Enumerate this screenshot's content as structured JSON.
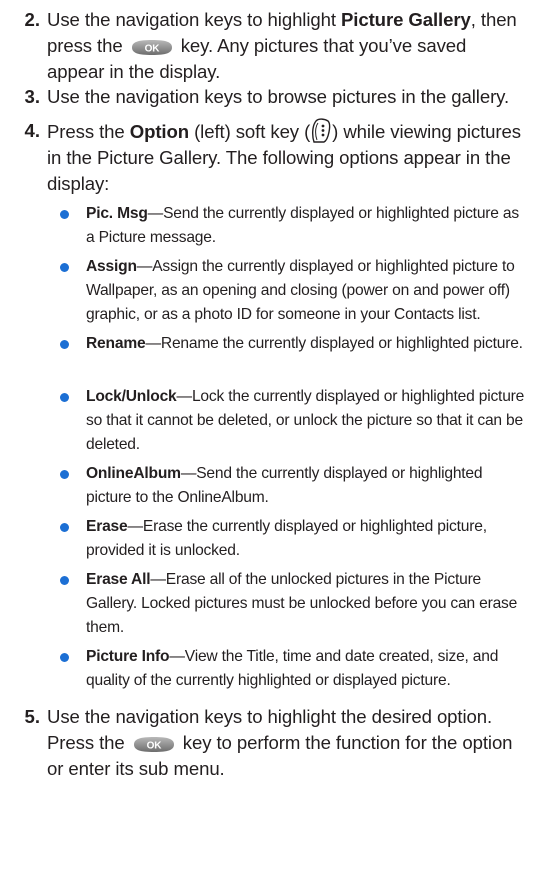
{
  "steps": [
    {
      "number": "2.",
      "parts": {
        "a": "Use the navigation keys to highlight ",
        "b_bold": "Picture Gallery",
        "c": ", then press the ",
        "ok_icon": "ok-key-icon",
        "d": " key. Any pictures that you’ve saved appear in the display."
      }
    },
    {
      "number": "3.",
      "text": "Use the navigation keys to browse pictures in the gallery."
    },
    {
      "number": "4.",
      "parts": {
        "a": "Press the ",
        "b_bold": "Option",
        "c": " (left) soft key (",
        "soft_icon": "left-soft-key-icon",
        "d": ") while viewing pictures in the Picture Gallery. The following options appear in the display:"
      }
    },
    {
      "number": "5.",
      "parts": {
        "a": "Use the navigation keys to highlight the desired option. Press the ",
        "ok_icon": "ok-key-icon",
        "b": " key to perform the function for the option or enter its sub menu."
      }
    }
  ],
  "options": [
    {
      "term": "Pic. Msg",
      "desc": "Send the currently displayed or highlighted picture as a Picture message."
    },
    {
      "term": "Assign",
      "desc": "Assign the currently displayed or highlighted picture to Wallpaper, as an opening and closing (power on and power off) graphic, or as a photo ID for someone in your Contacts list."
    },
    {
      "term": "Rename",
      "desc": "Rename the currently displayed or highlighted picture."
    },
    {
      "term": "Lock/Unlock",
      "desc": "Lock the currently displayed or highlighted picture so that it cannot be deleted, or unlock the picture so that it can be deleted."
    },
    {
      "term": "OnlineAlbum",
      "desc": "Send the currently displayed or highlighted picture to the OnlineAlbum."
    },
    {
      "term": "Erase",
      "desc": "Erase the currently displayed or highlighted picture, provided it is unlocked."
    },
    {
      "term": "Erase All",
      "desc": "Erase all of the unlocked pictures in the Picture Gallery. Locked pictures must be unlocked before you can erase them."
    },
    {
      "term": "Picture Info",
      "desc": "View the Title, time and date created, size, and quality of the currently highlighted or displayed picture."
    }
  ],
  "dash": "—",
  "ok_label": "OK",
  "colors": {
    "text": "#231f20",
    "bullet": "#1c6fd4",
    "ok_key": "#8a8a8a"
  }
}
